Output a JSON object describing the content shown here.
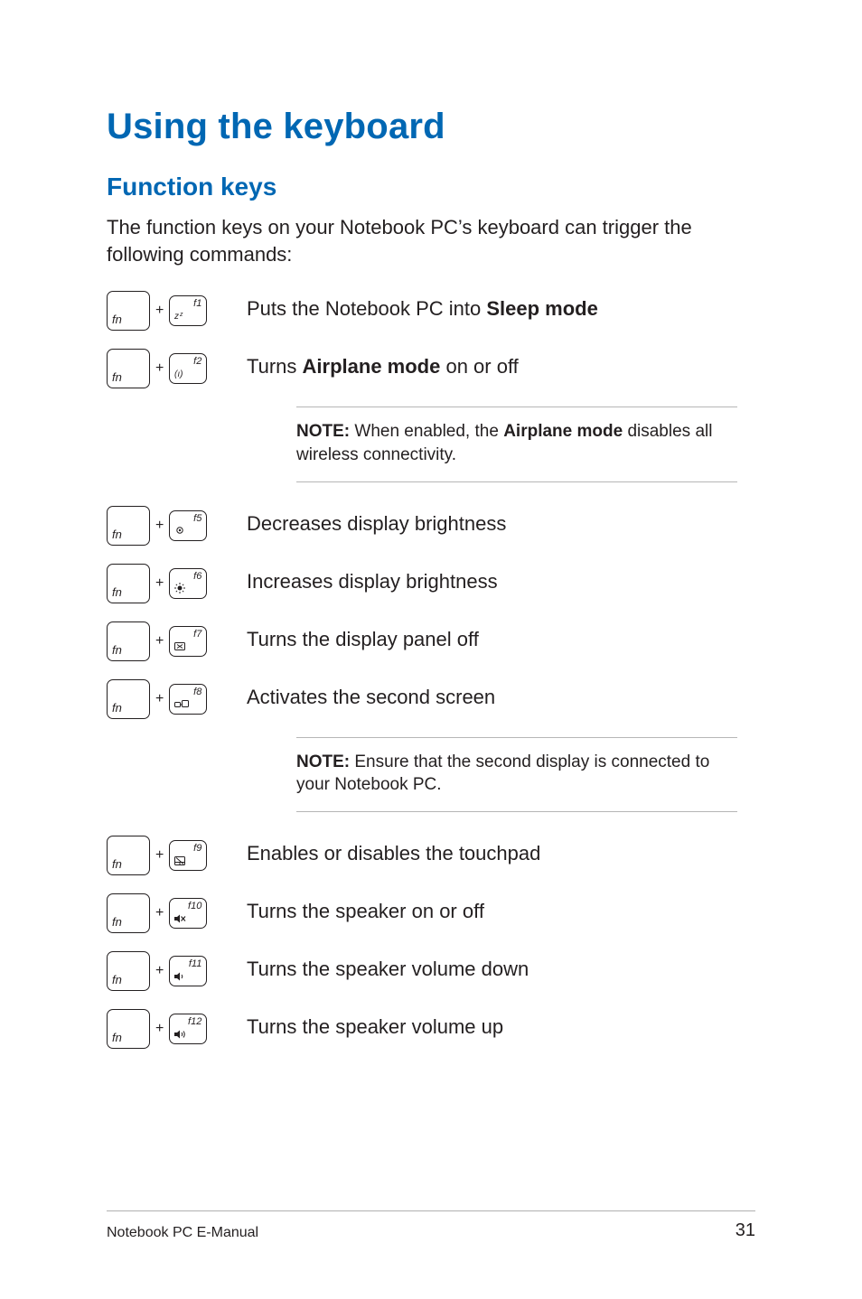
{
  "heading": "Using the keyboard",
  "subheading": "Function keys",
  "intro": "The function keys on your Notebook PC’s keyboard can trigger the following commands:",
  "fn_label": "fn",
  "plus": "+",
  "rows": {
    "f1": {
      "fkey": "f1",
      "icon": "sleep",
      "text_pre": "Puts the Notebook PC into ",
      "text_bold": "Sleep mode",
      "text_post": ""
    },
    "f2": {
      "fkey": "f2",
      "icon": "airplane",
      "text_pre": "Turns ",
      "text_bold": "Airplane mode",
      "text_post": " on or off"
    },
    "f5": {
      "fkey": "f5",
      "icon": "bright-down",
      "text": "Decreases display brightness"
    },
    "f6": {
      "fkey": "f6",
      "icon": "bright-up",
      "text": "Increases display brightness"
    },
    "f7": {
      "fkey": "f7",
      "icon": "display-off",
      "text": "Turns the display panel off"
    },
    "f8": {
      "fkey": "f8",
      "icon": "second-screen",
      "text": "Activates the second screen"
    },
    "f9": {
      "fkey": "f9",
      "icon": "touchpad",
      "text": "Enables or disables the touchpad"
    },
    "f10": {
      "fkey": "f10",
      "icon": "speaker-mute",
      "text": "Turns the speaker on or off"
    },
    "f11": {
      "fkey": "f11",
      "icon": "speaker-down",
      "text": "Turns the speaker volume down"
    },
    "f12": {
      "fkey": "f12",
      "icon": "speaker-up",
      "text": "Turns the speaker volume up"
    }
  },
  "notes": {
    "airplane": {
      "label": "NOTE:",
      "text": " When enabled, the ",
      "bold": "Airplane mode",
      "text2": " disables all wireless connectivity."
    },
    "screen": {
      "label": "NOTE:",
      "text": " Ensure that the second display is connected to your Notebook PC."
    }
  },
  "footer": {
    "title": "Notebook PC E-Manual",
    "page": "31"
  }
}
